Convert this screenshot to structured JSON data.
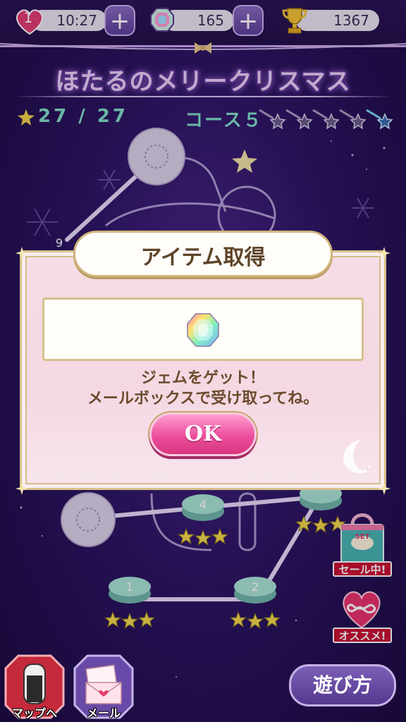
{
  "status": {
    "lives": "1",
    "time": "10:27",
    "gems": "165",
    "trophies": "1367"
  },
  "stage": {
    "title": "ほたるのメリークリスマス",
    "stars": "27 / 27",
    "course": "コース５"
  },
  "map_nodes": [
    {
      "label": "1"
    },
    {
      "label": "2"
    },
    {
      "label": "4"
    },
    {
      "label": "9"
    }
  ],
  "dialog": {
    "title": "アイテム取得",
    "item_icon": "rainbow-gem-icon",
    "message_line1": "ジェムをゲット！",
    "message_line2": "メールボックスで受け取ってね。",
    "ok_label": "OK"
  },
  "promos": {
    "sale_label": "セール中!",
    "sale_bag_text": "SET",
    "recommend_label": "オススメ!"
  },
  "bottom": {
    "map_label": "マップへ",
    "mail_label": "メール",
    "howto_label": "遊び方"
  },
  "colors": {
    "accent_pink": "#ec4e9d",
    "mint_text": "#7fe0c4",
    "background": "#2c1560"
  }
}
